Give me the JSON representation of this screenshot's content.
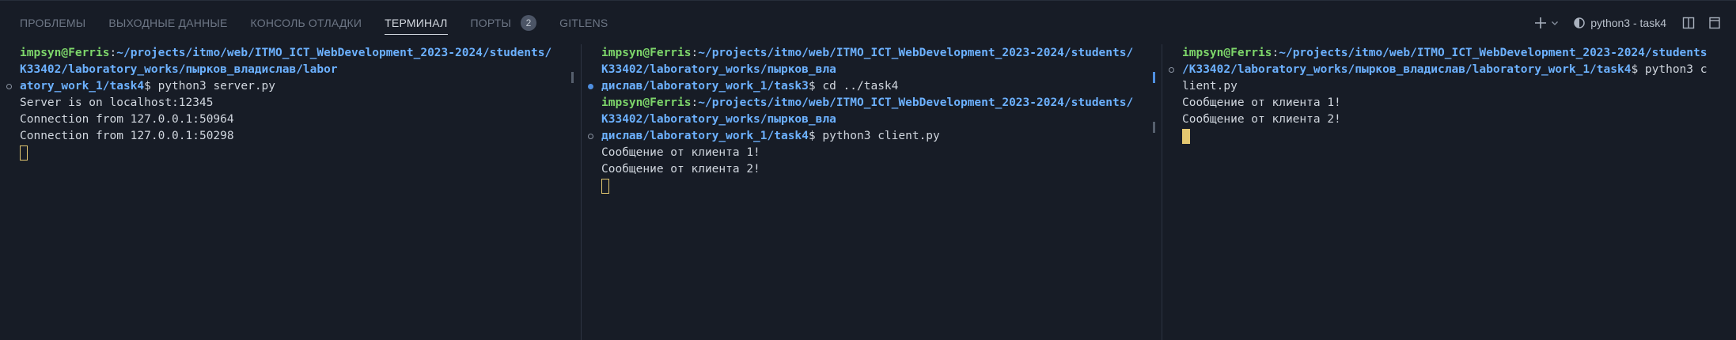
{
  "tabs": [
    {
      "label": "ПРОБЛЕМЫ"
    },
    {
      "label": "ВЫХОДНЫЕ ДАННЫЕ"
    },
    {
      "label": "КОНСОЛЬ ОТЛАДКИ"
    },
    {
      "label": "ТЕРМИНАЛ",
      "active": true
    },
    {
      "label": "ПОРТЫ",
      "badge": "2"
    },
    {
      "label": "GITLENS"
    }
  ],
  "actions": {
    "add_icon": "plus-icon",
    "dropdown_icon": "chevron-down-icon",
    "terminal_icon": "terminal-python-icon",
    "terminal_name": "python3 - task4",
    "split_icon": "split-terminal-icon",
    "maximize_icon": "maximize-panel-icon"
  },
  "colors": {
    "user": "#7dd66a",
    "path": "#6cb1ff",
    "cursor": "#e3c770",
    "background": "#171c26"
  },
  "panes": [
    {
      "prompt": {
        "user": "impsyn@Ferris",
        "sep": ":",
        "path_lines": [
          "~/projects/itmo/web/ITMO_ICT_WebDevelopment_2023-2024/students/",
          "K33402/laboratory_works/пырков_владислав/labor",
          "atory_work_1/task4"
        ],
        "command": "$ python3 server.py"
      },
      "output": [
        "Server is on localhost:12345",
        "Connection from 127.0.0.1:50964",
        "Connection from 127.0.0.1:50298"
      ]
    },
    {
      "prompt1": {
        "user": "impsyn@Ferris",
        "sep": ":",
        "path_lines": [
          "~/projects/itmo/web/ITMO_ICT_WebDevelopment_2023-2024/students/",
          "K33402/laboratory_works/пырков_вла",
          "дислав/laboratory_work_1/task3"
        ],
        "command": "$ cd ../task4"
      },
      "prompt2": {
        "user": "impsyn@Ferris",
        "sep": ":",
        "path_lines": [
          "~/projects/itmo/web/ITMO_ICT_WebDevelopment_2023-2024/students/",
          "K33402/laboratory_works/пырков_вла",
          "дислав/laboratory_work_1/task4"
        ],
        "command": "$ python3 client.py"
      },
      "output": [
        "Сообщение от клиента 1!",
        "Сообщение от клиента 2!"
      ]
    },
    {
      "prompt": {
        "user": "impsyn@Ferris",
        "sep": ":",
        "path_lines": [
          "~/projects/itmo/web/ITMO_ICT_WebDevelopment_2023-2024/students",
          "/K33402/laboratory_works/пырков_владислав/laboratory_work_1/task4"
        ],
        "command": "$ python3 c",
        "command_wrap": "lient.py"
      },
      "output": [
        "Сообщение от клиента 1!",
        "Сообщение от клиента 2!"
      ]
    }
  ]
}
